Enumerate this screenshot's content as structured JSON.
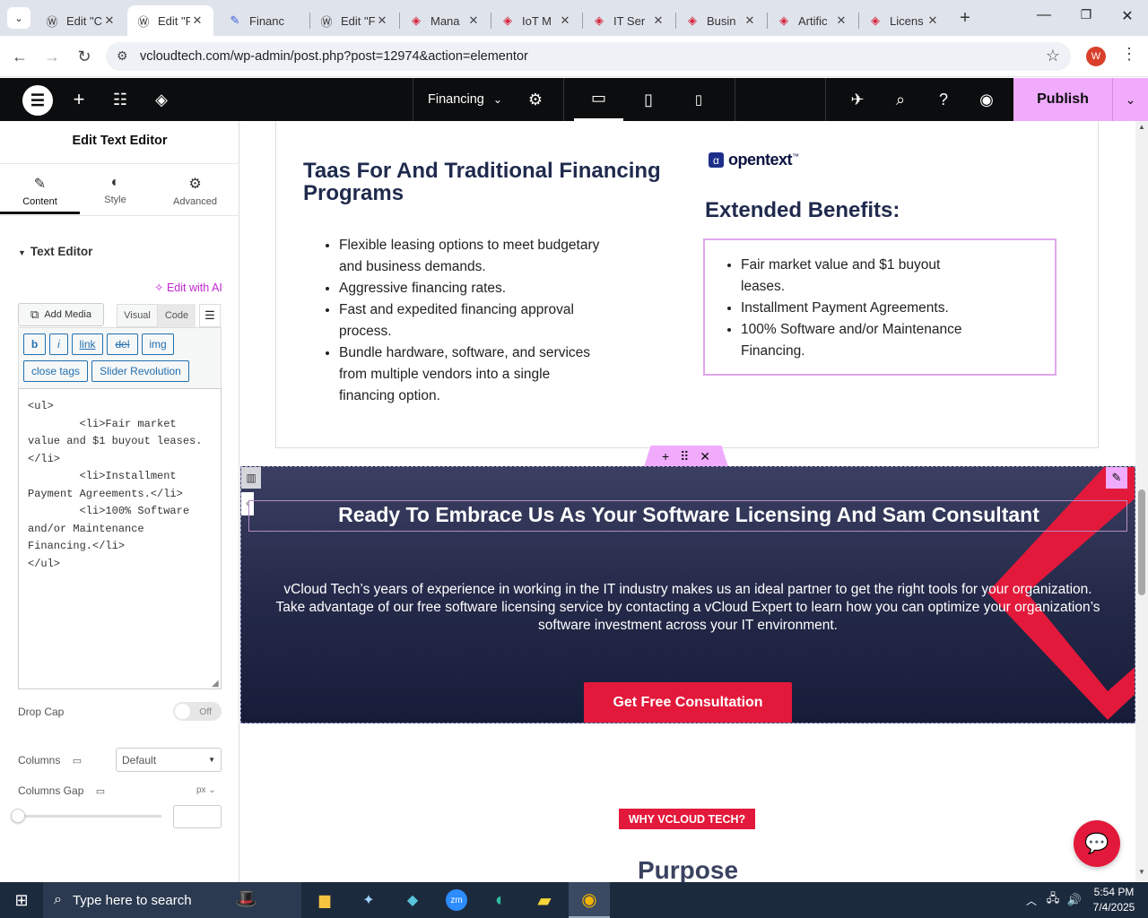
{
  "browser": {
    "tabs": [
      {
        "title": "Edit \"C",
        "active": false
      },
      {
        "title": "Edit \"F",
        "active": true
      },
      {
        "title": "Financ",
        "active": false
      },
      {
        "title": "Edit \"F",
        "active": false
      },
      {
        "title": "Mana",
        "active": false
      },
      {
        "title": "IoT M",
        "active": false
      },
      {
        "title": "IT Ser",
        "active": false
      },
      {
        "title": "Busin",
        "active": false
      },
      {
        "title": "Artific",
        "active": false
      },
      {
        "title": "Licens",
        "active": false
      }
    ],
    "url": "vcloudtech.com/wp-admin/post.php?post=12974&action=elementor",
    "profile_initial": "W"
  },
  "elementor": {
    "page_name": "Financing",
    "publish_label": "Publish"
  },
  "panel": {
    "title": "Edit Text Editor",
    "tabs": [
      "Content",
      "Style",
      "Advanced"
    ],
    "section_title": "Text Editor",
    "edit_with_ai": "Edit with AI",
    "add_media": "Add Media",
    "visual_tab": "Visual",
    "code_tab": "Code",
    "quicktags": [
      "b",
      "i",
      "link",
      "del",
      "img",
      "close tags",
      "Slider Revolution"
    ],
    "code_lines": [
      "<ul>",
      "        <li>Fair market",
      "value and $1 buyout leases.",
      "</li>",
      "        <li>Installment",
      "Payment Agreements.</li>",
      "        <li>100% Software",
      "and/or Maintenance",
      "Financing.</li>",
      "</ul>"
    ],
    "drop_cap_label": "Drop Cap",
    "drop_cap_value": "Off",
    "columns_label": "Columns",
    "columns_value": "Default",
    "columns_gap_label": "Columns Gap",
    "columns_gap_unit": "px"
  },
  "content": {
    "left_heading": "Taas For And Traditional Financing Programs",
    "left_list": [
      "Flexible leasing options to meet budgetary and business demands.",
      "Aggressive financing rates.",
      "Fast and expedited financing approval process.",
      "Bundle hardware, software, and services from multiple vendors into a single financing option."
    ],
    "logo_text": "opentext",
    "right_heading": "Extended Benefits:",
    "right_list": [
      "Fair market value and $1 buyout leases.",
      "Installment Payment Agreements.",
      "100% Software and/or Maintenance Financing."
    ],
    "cta_heading": "Ready To Embrace Us As Your Software Licensing And Sam Consultant",
    "cta_text": "vCloud Tech’s years of experience in working in the IT industry makes us an ideal partner to get the right tools for your organization. Take advantage of our free software licensing service by contacting a vCloud Expert to learn how you can optimize your organization’s software investment across your IT environment.",
    "cta_button": "Get Free Consultation",
    "why_badge": "WHY VCLOUD TECH?",
    "purpose_heading": "Purpose"
  },
  "taskbar": {
    "search_placeholder": "Type here to search",
    "time": "5:54 PM",
    "date": "7/4/2025"
  },
  "colors": {
    "accent_red": "#e3193b",
    "elementor_pink": "#f0abfc",
    "navy": "#1f2a4d"
  }
}
